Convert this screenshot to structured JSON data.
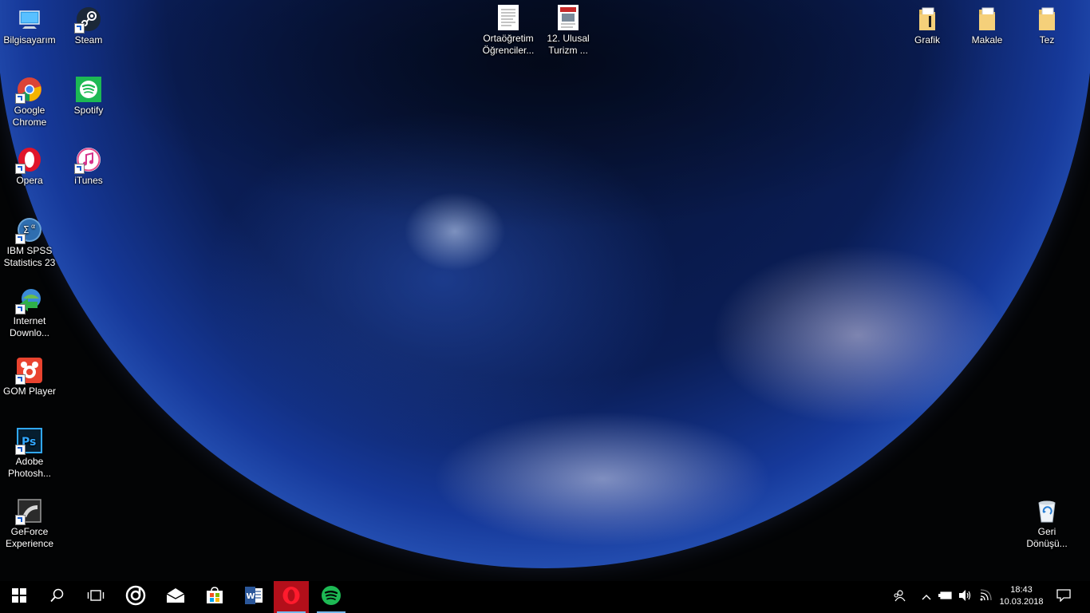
{
  "desktop_icons_left": [
    {
      "label": "Bilgisayarım",
      "icon": "computer-icon"
    },
    {
      "label": "Steam",
      "icon": "steam-icon"
    },
    {
      "label": "Google Chrome",
      "icon": "chrome-icon"
    },
    {
      "label": "Spotify",
      "icon": "spotify-icon"
    },
    {
      "label": "Opera",
      "icon": "opera-icon"
    },
    {
      "label": "iTunes",
      "icon": "itunes-icon"
    },
    {
      "label": "IBM SPSS Statistics 23",
      "icon": "spss-icon"
    },
    {
      "label": "Internet Downlo...",
      "icon": "internet-download-manager-icon"
    },
    {
      "label": "GOM Player",
      "icon": "gom-player-icon"
    },
    {
      "label": "Adobe Photosh...",
      "icon": "photoshop-icon"
    },
    {
      "label": "GeForce Experience",
      "icon": "geforce-experience-icon"
    }
  ],
  "desktop_icons_top": [
    {
      "label": "Ortaöğretim Öğrenciler...",
      "icon": "document-icon"
    },
    {
      "label": "12. Ulusal Turizm ...",
      "icon": "document-icon"
    }
  ],
  "desktop_icons_right": [
    {
      "label": "Grafik",
      "icon": "folder-icon"
    },
    {
      "label": "Makale",
      "icon": "folder-icon"
    },
    {
      "label": "Tez",
      "icon": "folder-icon"
    },
    {
      "label": "Geri Dönüşü...",
      "icon": "recycle-bin-icon"
    }
  ],
  "taskbar": {
    "start": "windows-start-icon",
    "search": "search-icon",
    "task_view": "task-view-icon",
    "pinned": [
      "groove-music-icon",
      "mail-icon",
      "store-icon",
      "word-icon",
      "opera-icon",
      "spotify-icon"
    ]
  },
  "tray": {
    "time": "18:43",
    "date": "10.03.2018"
  },
  "colors": {
    "taskbar_bg": "#000000",
    "accent": "#76b9ed",
    "opera_red": "#c50d1d",
    "spotify_green": "#1db954"
  }
}
